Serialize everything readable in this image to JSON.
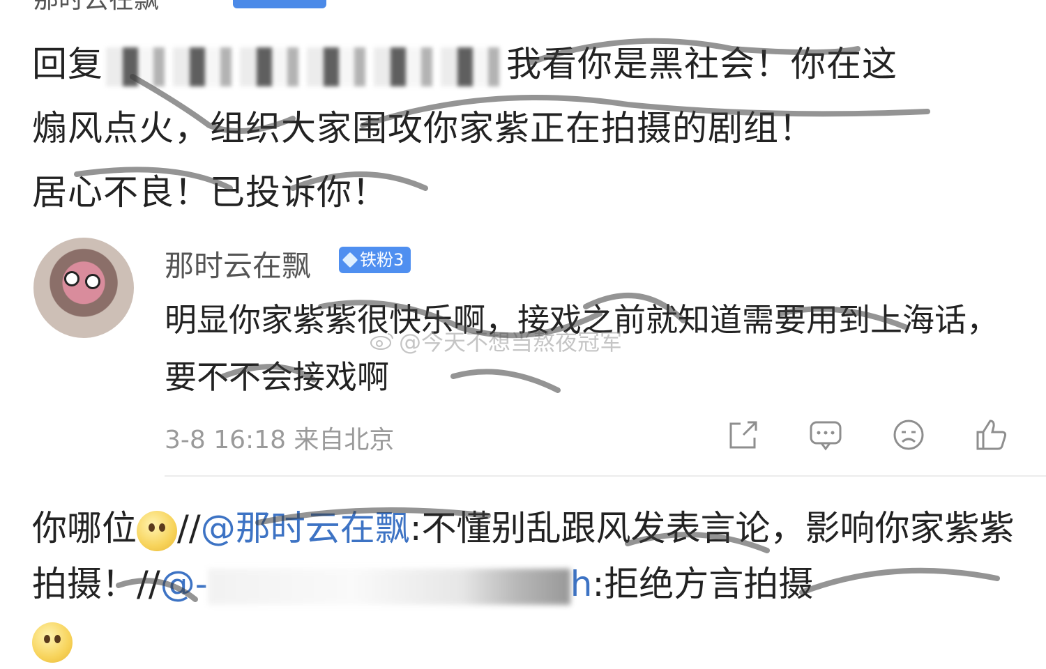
{
  "top": {
    "username_partial": "那时云在飘"
  },
  "reply": {
    "prefix": "回复",
    "line1": "我看你是黑社会！你在这",
    "line2": "煽风点火，组织大家围攻你家紫正在拍摄的剧组！",
    "line3": "居心不良！已投诉你！"
  },
  "comment": {
    "username": "那时云在飘",
    "badge": "铁粉3",
    "text": "明显你家紫紫很快乐啊，接戏之前就知道需要用到上海话，要不不会接戏啊",
    "meta": "3-8 16:18 来自北京",
    "watermark": "@今天不想当熬夜冠军"
  },
  "actions": {
    "share": "share-icon",
    "reply": "comment-icon",
    "dislike": "sad-face-icon",
    "like": "thumbs-up-icon"
  },
  "repost": {
    "part1": "你哪位",
    "sep1": "//",
    "mention1": "@那时云在飘",
    "text1": ":不懂别乱跟风发表言论，影响你家紫紫拍摄！",
    "sep2": "//",
    "mention2_start": "@-",
    "mention2_end": "h",
    "text2": ":拒绝方言拍摄"
  }
}
